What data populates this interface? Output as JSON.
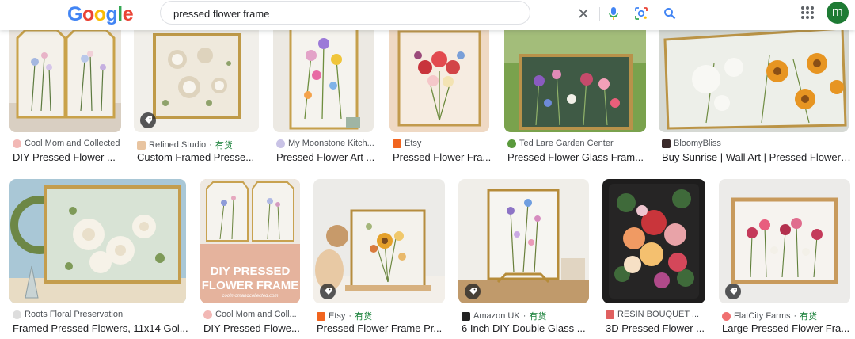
{
  "logo": [
    "G",
    "o",
    "o",
    "g",
    "l",
    "e"
  ],
  "logo_colors": [
    "#4285F4",
    "#EA4335",
    "#FBBC05",
    "#4285F4",
    "#34A853",
    "#EA4335"
  ],
  "search": {
    "value": "pressed flower frame"
  },
  "icons": {
    "clear": "close-icon",
    "voice": "microphone-icon",
    "lens": "camera-lens-icon",
    "search": "search-icon",
    "apps": "apps-grid-icon"
  },
  "account": {
    "initial": "m",
    "color": "#1e7b34"
  },
  "stock_label": "有货",
  "row1": [
    {
      "source": "Cool Mom and Collected",
      "title": "DIY Pressed Flower ...",
      "fav_color": "#f2b8b5",
      "stock": false,
      "tag": false
    },
    {
      "source": "Refined Studio",
      "title": "Custom Framed Presse...",
      "fav_color": "#e8c4a0",
      "stock": true,
      "tag": true
    },
    {
      "source": "My Moonstone Kitch...",
      "title": "Pressed Flower Art ...",
      "fav_color": "#c9c3e6",
      "stock": false,
      "tag": false
    },
    {
      "source": "Etsy",
      "title": "Pressed Flower Fra...",
      "fav_color": "#f1641e",
      "stock": false,
      "tag": false
    },
    {
      "source": "Ted Lare Garden Center",
      "title": "Pressed Flower Glass Fram...",
      "fav_color": "#5a9a3c",
      "stock": false,
      "tag": false
    },
    {
      "source": "BloomyBliss",
      "title": "Buy Sunrise | Wall Art | Pressed Flower ...",
      "fav_color": "#3a2a2a",
      "stock": false,
      "tag": false
    }
  ],
  "row2": [
    {
      "source": "Roots Floral Preservation",
      "title": "Framed Pressed Flowers, 11x14 Gol...",
      "fav_color": "#dddddd",
      "stock": false,
      "tag": false
    },
    {
      "source": "Cool Mom and Coll...",
      "title": "DIY Pressed Flowe...",
      "fav_color": "#f2b8b5",
      "stock": false,
      "tag": false,
      "overlay_title": "DIY PRESSED FLOWER FRAME",
      "overlay_sub": "coolmomandcollected.com"
    },
    {
      "source": "Etsy",
      "title": "Pressed Flower Frame Pr...",
      "fav_color": "#f1641e",
      "stock": true,
      "tag": true
    },
    {
      "source": "Amazon UK",
      "title": "6 Inch DIY Double Glass ...",
      "fav_color": "#222222",
      "stock": true,
      "tag": true
    },
    {
      "source": "RESIN BOUQUET ...",
      "title": "3D Pressed Flower ...",
      "fav_color": "#e06060",
      "stock": false,
      "tag": false
    },
    {
      "source": "FlatCity Farms",
      "title": "Large Pressed Flower Fra...",
      "fav_color": "#f07070",
      "stock": true,
      "tag": true
    }
  ]
}
